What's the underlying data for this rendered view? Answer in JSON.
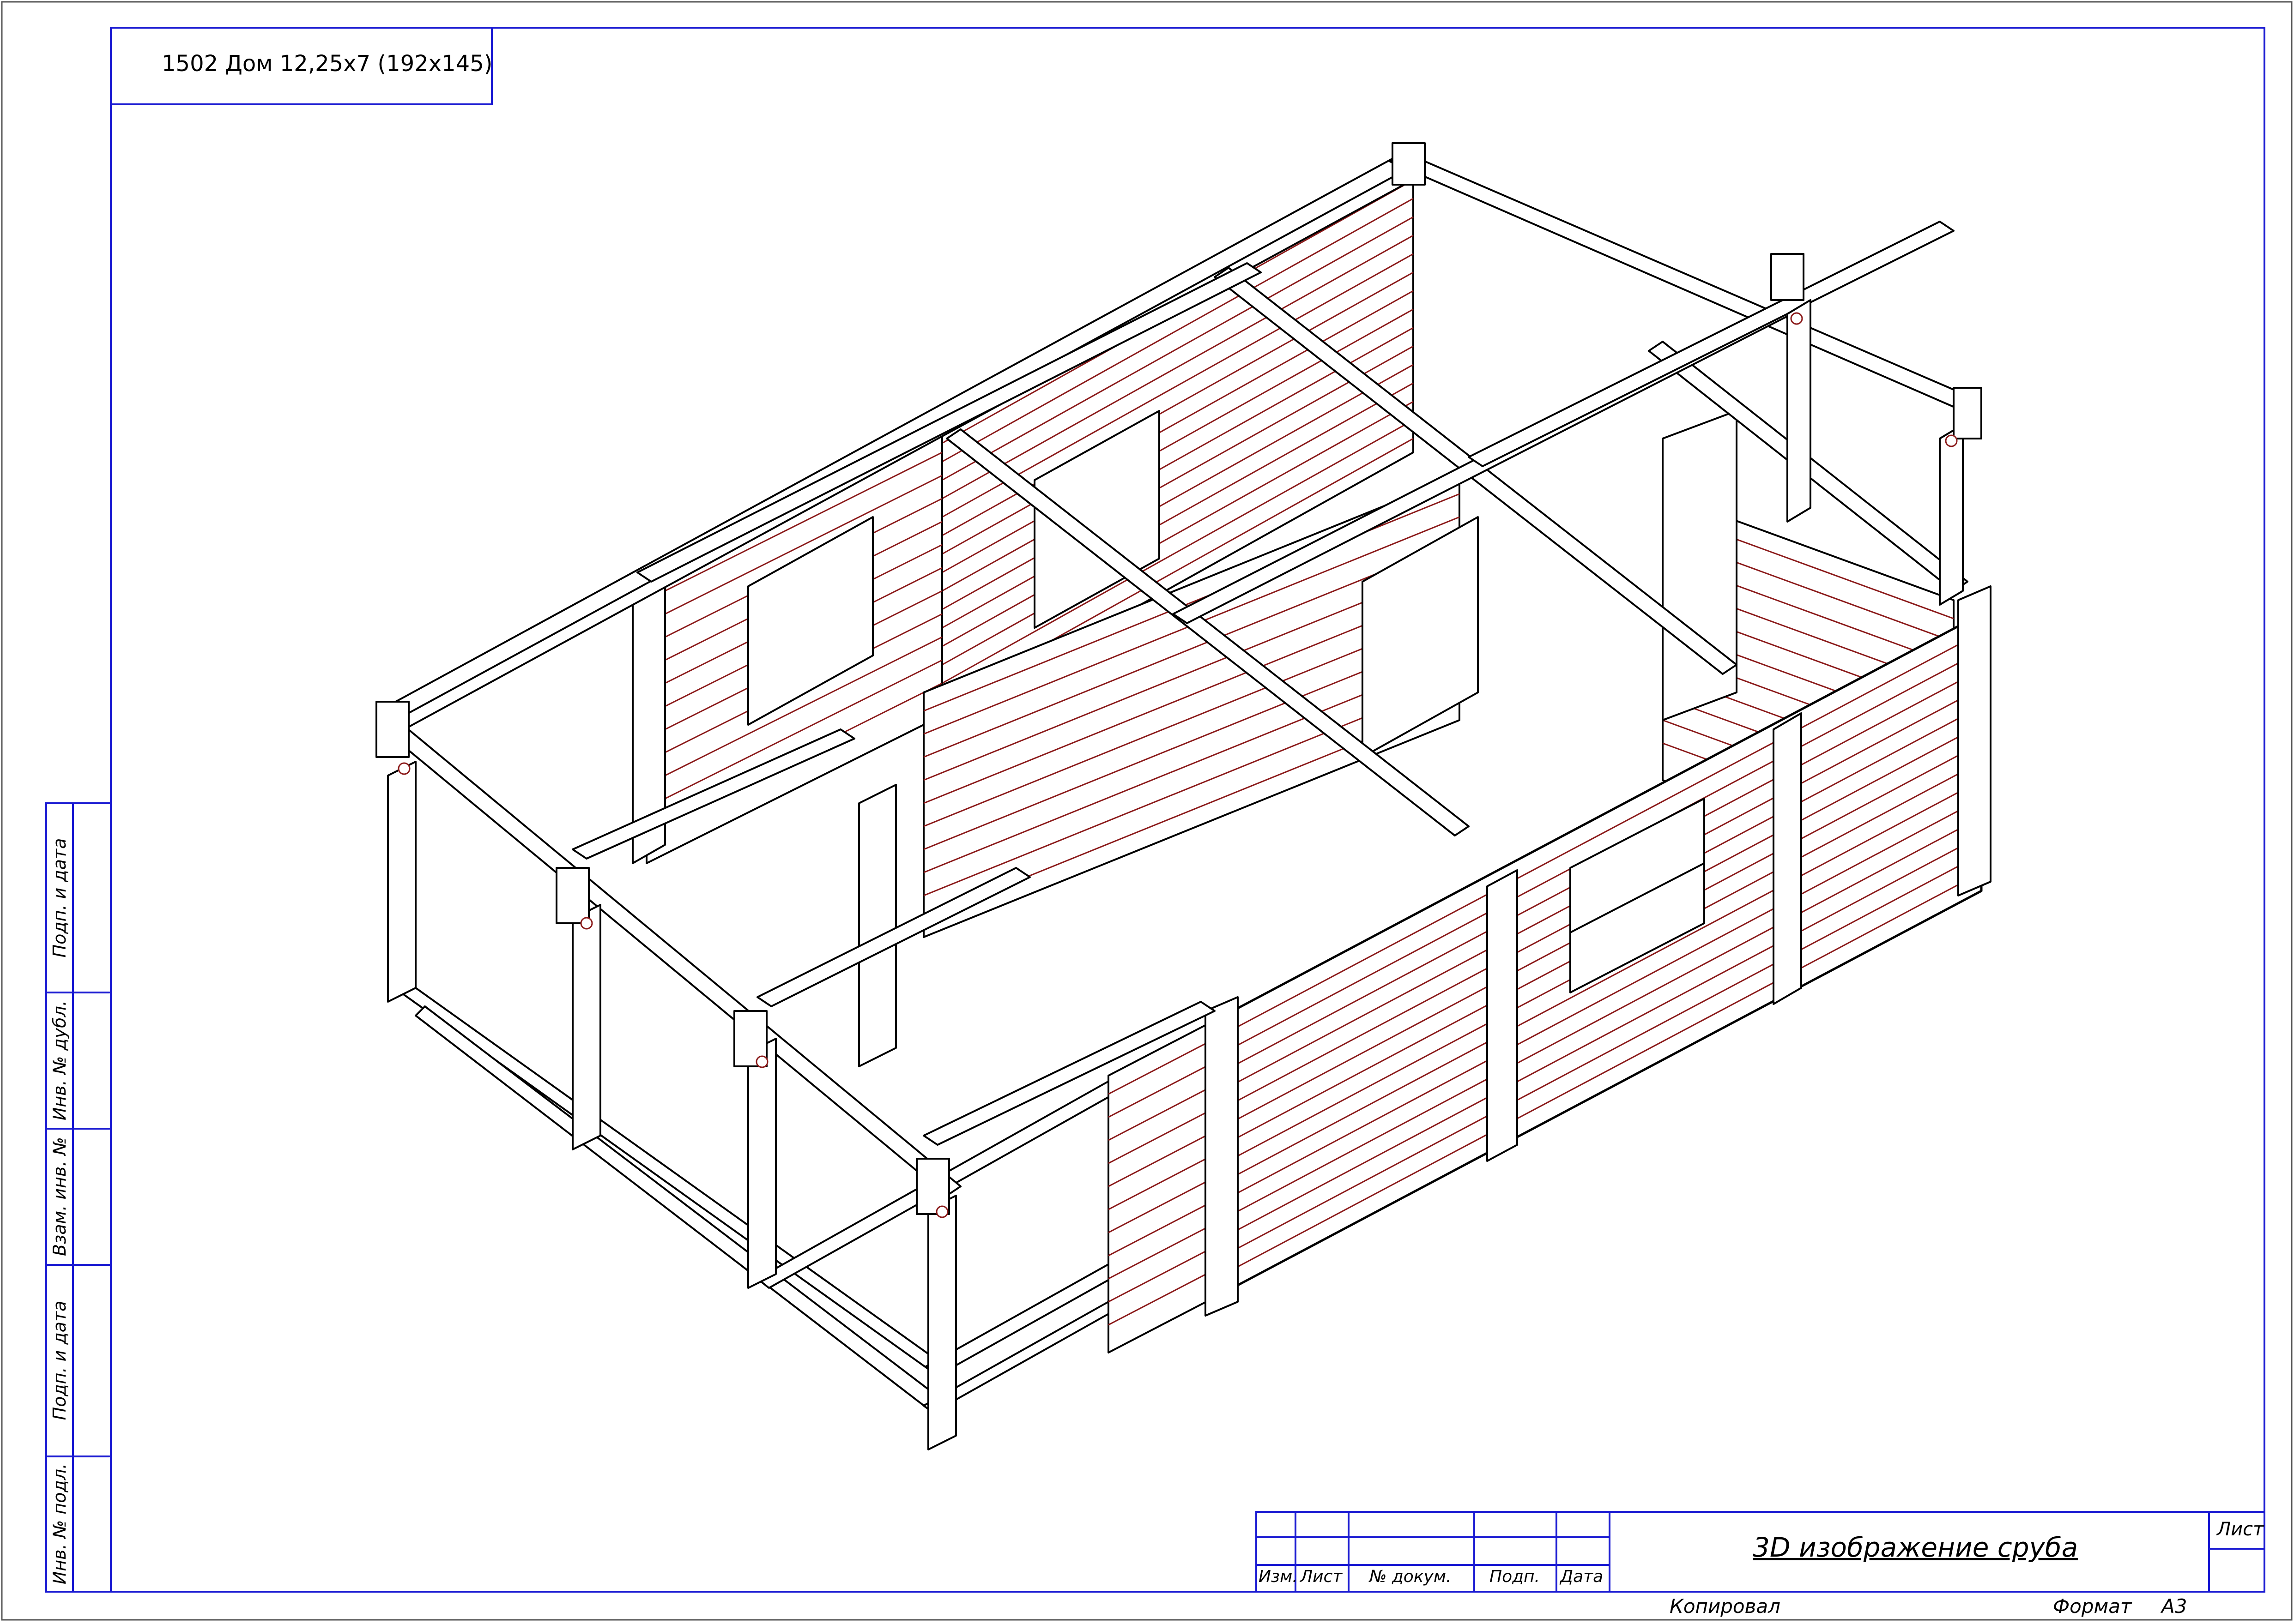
{
  "header": {
    "project_title": "1502 Дом 12,25x7 (192x145)"
  },
  "side_stamp": {
    "labels": [
      "Подп. и дата",
      "Инв. № дубл.",
      "Взам. инв. №",
      "Подп. и дата",
      "Инв. № подл."
    ]
  },
  "title_block": {
    "drawing_name": "3D изображение сруба",
    "sheet_label": "Лист",
    "columns": [
      "Изм.",
      "Лист",
      "№ докум.",
      "Подп.",
      "Дата"
    ]
  },
  "footer": {
    "copied_by": "Копировал",
    "format_label": "Формат",
    "format_value": "A3"
  },
  "colors": {
    "frame": "#1a1ad2",
    "outline": "#000000",
    "log_lines": "#8b1a1a",
    "sheet_border": "#555555"
  }
}
